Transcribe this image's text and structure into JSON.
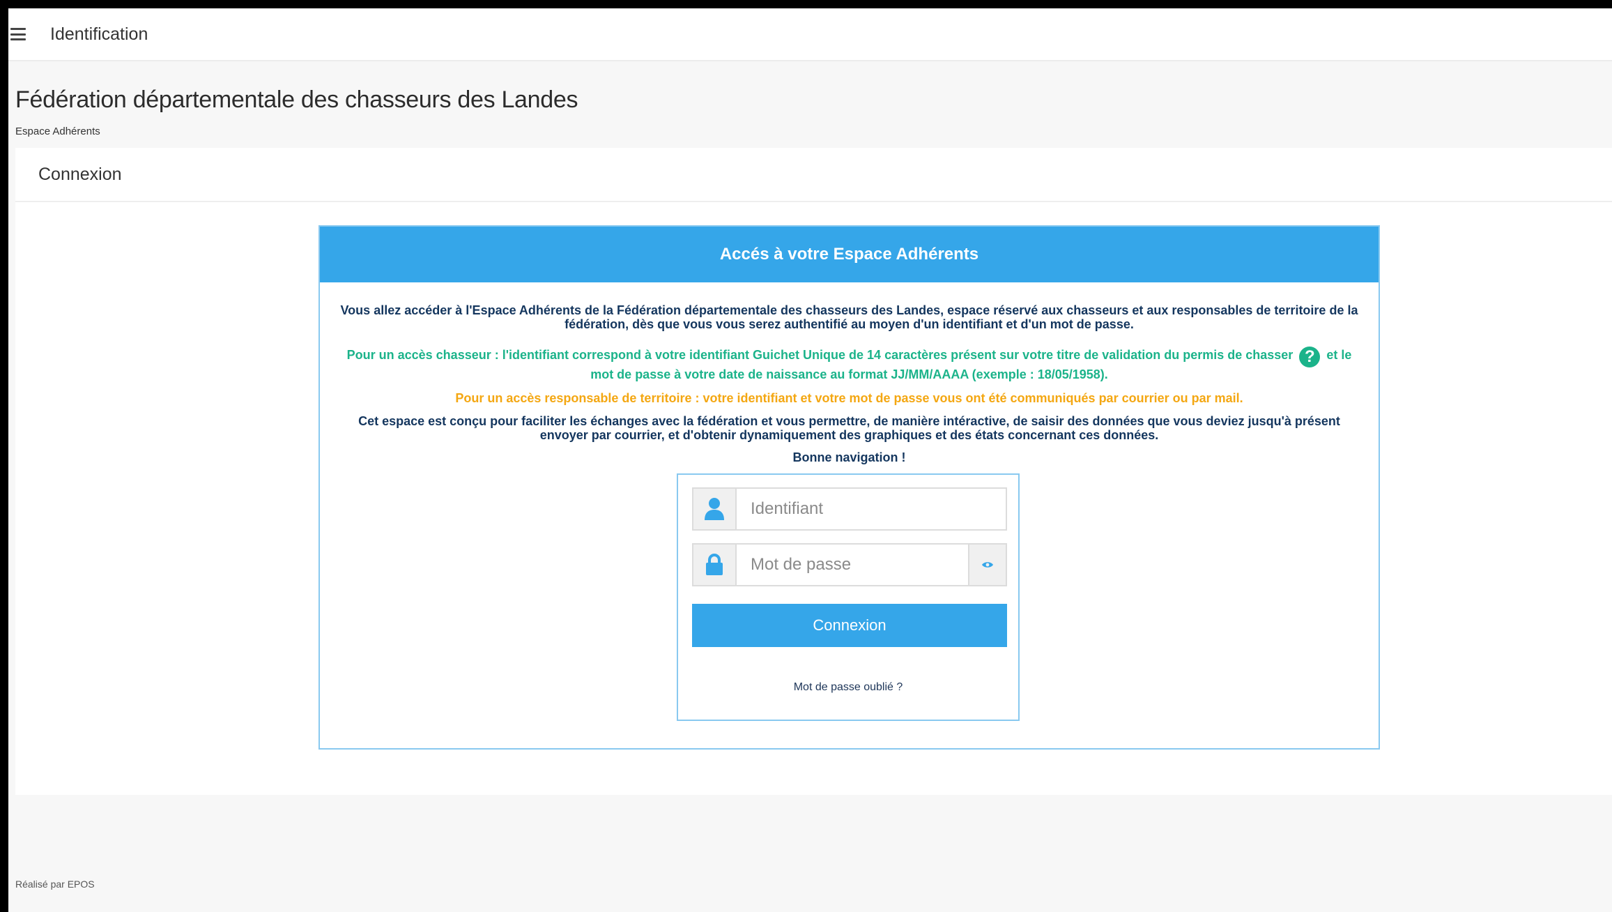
{
  "topbar": {
    "title": "Identification",
    "menu_icon": "hamburger-menu-icon"
  },
  "header": {
    "title": "Fédération départementale des chasseurs des Landes",
    "subtitle": "Espace Adhérents"
  },
  "panel": {
    "heading": "Connexion"
  },
  "access": {
    "title": "Accés à votre Espace Adhérents",
    "intro": "Vous allez accéder à l'Espace Adhérents de la Fédération départementale des chasseurs des Landes, espace réservé aux chasseurs et aux responsables de territoire de la fédération, dès que vous vous serez authentifié au moyen d'un identifiant et d'un mot de passe.",
    "hunter_part1": "Pour un accès chasseur : l'identifiant correspond à votre identifiant Guichet Unique de 14 caractères présent sur votre titre de validation du permis de chasser",
    "help_glyph": "?",
    "hunter_part2": "et le mot de passe à votre date de naissance au format JJ/MM/AAAA (exemple : 18/05/1958).",
    "territory": "Pour un accès responsable de territoire : votre identifiant et votre mot de passe vous ont été communiqués par courrier ou par mail.",
    "info": "Cet espace est conçu pour faciliter les échanges avec la fédération et vous permettre, de manière intéractive, de saisir des données que vous deviez jusqu'à présent envoyer par courrier, et d'obtenir dynamiquement des graphiques et des états concernant ces données.",
    "bonne": "Bonne navigation !"
  },
  "login": {
    "username_placeholder": "Identifiant",
    "username_value": "",
    "password_placeholder": "Mot de passe",
    "password_value": "",
    "submit_label": "Connexion",
    "forgot_label": "Mot de passe oublié ?",
    "icons": {
      "user": "user-icon",
      "lock": "lock-icon",
      "eye": "eye-icon"
    }
  },
  "footer": {
    "credit": "Réalisé par EPOS"
  },
  "colors": {
    "accent": "#35a6e9",
    "border_light_blue": "#89c9f0",
    "text_navy": "#14365e",
    "text_green": "#1bb38a",
    "text_orange": "#f4a712"
  }
}
